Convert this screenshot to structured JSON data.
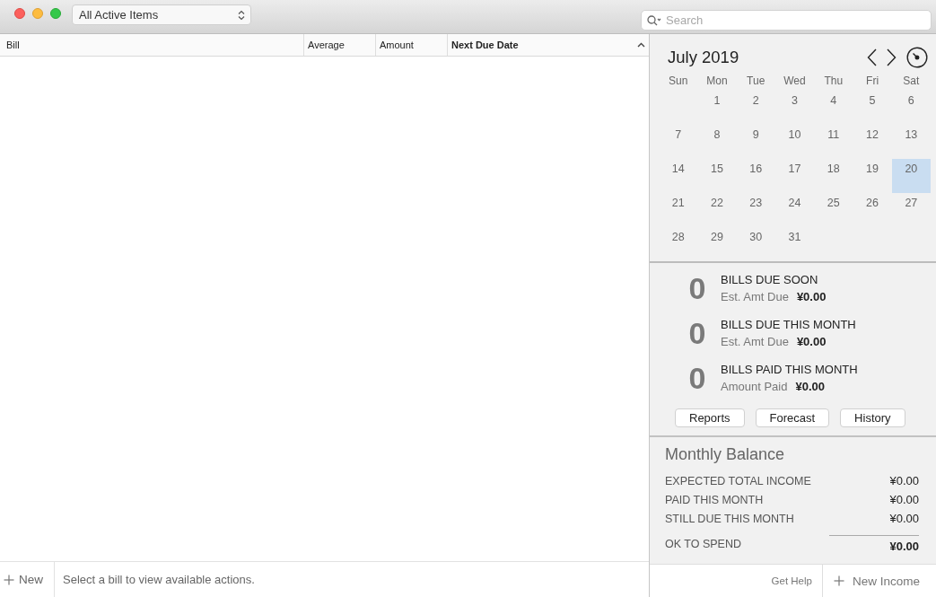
{
  "toolbar": {
    "filter": {
      "value": "All Active Items"
    },
    "search": {
      "placeholder": "Search"
    }
  },
  "table": {
    "columns": [
      {
        "label": "Bill",
        "sorted": false
      },
      {
        "label": "Average",
        "sorted": false
      },
      {
        "label": "Amount",
        "sorted": false
      },
      {
        "label": "Next Due Date",
        "sorted": true
      }
    ]
  },
  "bill_bar": {
    "new_button": "New",
    "status": "Select a bill to view available actions."
  },
  "calendar": {
    "title": "July 2019",
    "weekdays": [
      "Sun",
      "Mon",
      "Tue",
      "Wed",
      "Thu",
      "Fri",
      "Sat"
    ],
    "weeks": [
      [
        {
          "day": "1",
          "selected": false
        },
        {
          "day": "2",
          "selected": false
        },
        {
          "day": "3",
          "selected": false
        },
        {
          "day": "4",
          "selected": false
        },
        {
          "day": "5",
          "selected": false
        },
        {
          "day": "6",
          "selected": false
        }
      ],
      [
        {
          "day": "7",
          "selected": false
        },
        {
          "day": "8",
          "selected": false
        },
        {
          "day": "9",
          "selected": false
        },
        {
          "day": "10",
          "selected": false
        },
        {
          "day": "11",
          "selected": false
        },
        {
          "day": "12",
          "selected": false
        },
        {
          "day": "13",
          "selected": false
        }
      ],
      [
        {
          "day": "14",
          "selected": false
        },
        {
          "day": "15",
          "selected": false
        },
        {
          "day": "16",
          "selected": false
        },
        {
          "day": "17",
          "selected": false
        },
        {
          "day": "18",
          "selected": false
        },
        {
          "day": "19",
          "selected": false
        },
        {
          "day": "20",
          "selected": true
        }
      ],
      [
        {
          "day": "21",
          "selected": false
        },
        {
          "day": "22",
          "selected": false
        },
        {
          "day": "23",
          "selected": false
        },
        {
          "day": "24",
          "selected": false
        },
        {
          "day": "25",
          "selected": false
        },
        {
          "day": "26",
          "selected": false
        },
        {
          "day": "27",
          "selected": false
        }
      ],
      [
        {
          "day": "28",
          "selected": false
        },
        {
          "day": "29",
          "selected": false
        },
        {
          "day": "30",
          "selected": false
        },
        {
          "day": "31",
          "selected": false
        }
      ]
    ]
  },
  "summary": {
    "items": [
      {
        "count": "0",
        "title": "BILLS DUE SOON",
        "label": "Est. Amt Due",
        "amount": "¥0.00"
      },
      {
        "count": "0",
        "title": "BILLS DUE THIS MONTH",
        "label": "Est. Amt Due",
        "amount": "¥0.00"
      },
      {
        "count": "0",
        "title": "BILLS PAID THIS MONTH",
        "label": "Amount Paid",
        "amount": "¥0.00"
      }
    ],
    "buttons": [
      "Reports",
      "Forecast",
      "History"
    ]
  },
  "balance": {
    "title": "Monthly Balance",
    "rows": [
      {
        "kind": "line",
        "label": "EXPECTED TOTAL INCOME",
        "value": "¥0.00"
      },
      {
        "kind": "line",
        "label": "PAID THIS MONTH",
        "value": "¥0.00"
      },
      {
        "kind": "line",
        "label": "STILL DUE THIS MONTH",
        "value": "¥0.00"
      },
      {
        "kind": "total",
        "label": "OK TO SPEND",
        "value": "¥0.00"
      }
    ]
  },
  "footer": {
    "help_link": "Get Help",
    "new_income_button": "New Income"
  }
}
